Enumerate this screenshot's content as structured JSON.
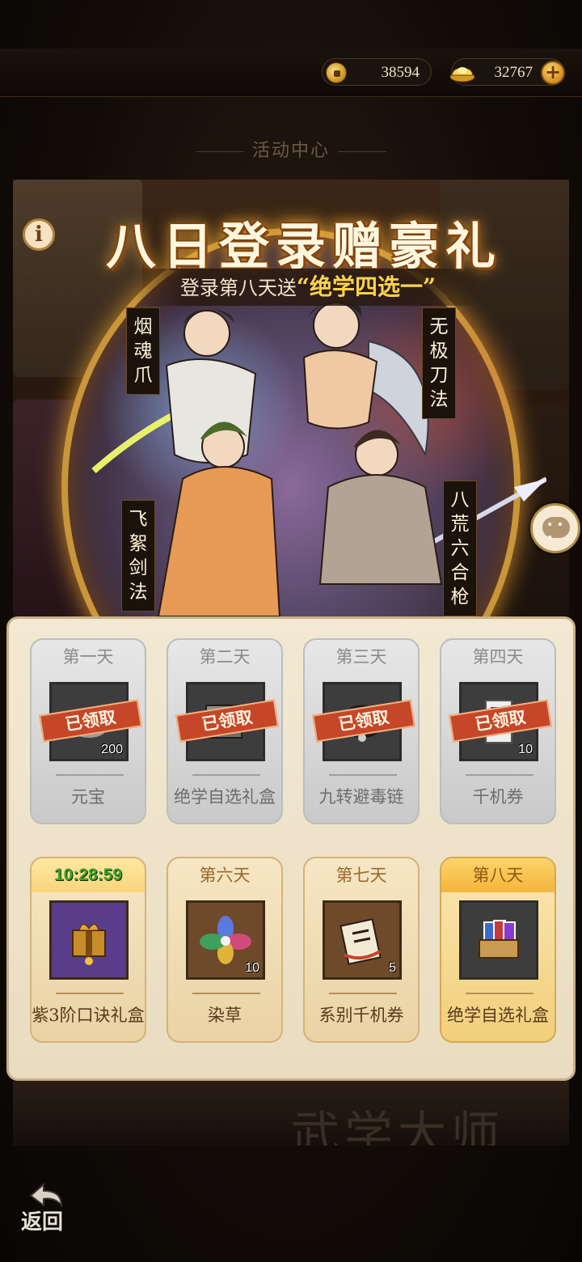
{
  "currency": {
    "coins": "38594",
    "ingots": "32767",
    "plus": "+"
  },
  "section_title": "活动中心",
  "banner": {
    "title": "八日登录赠豪礼",
    "subtitle_prefix": "登录第八天送",
    "subtitle_highlight": "“绝学四选一”",
    "skills": [
      "烟魂爪",
      "无极刀法",
      "飞絮剑法",
      "八荒六合枪"
    ],
    "info": "i"
  },
  "rewards": [
    {
      "day": "第一天",
      "name": "元宝",
      "qty": "200",
      "status": "已领取"
    },
    {
      "day": "第二天",
      "name": "绝学自选礼盒",
      "qty": "",
      "status": "已领取"
    },
    {
      "day": "第三天",
      "name": "九转避毒链",
      "qty": "",
      "status": "已领取"
    },
    {
      "day": "第四天",
      "name": "千机券",
      "qty": "10",
      "status": "已领取"
    },
    {
      "day": "10:28:59",
      "name": "紫3阶口诀礼盒",
      "qty": "",
      "status": ""
    },
    {
      "day": "第六天",
      "name": "染草",
      "qty": "10",
      "status": ""
    },
    {
      "day": "第七天",
      "name": "系别千机券",
      "qty": "5",
      "status": ""
    },
    {
      "day": "第八天",
      "name": "绝学自选礼盒",
      "qty": "",
      "status": ""
    }
  ],
  "bottom": {
    "faded_title": "武学大师",
    "back_label": "返回"
  },
  "colors": {
    "gold": "#c99639",
    "stamp": "#c6462a",
    "timer": "#3ea12c"
  }
}
